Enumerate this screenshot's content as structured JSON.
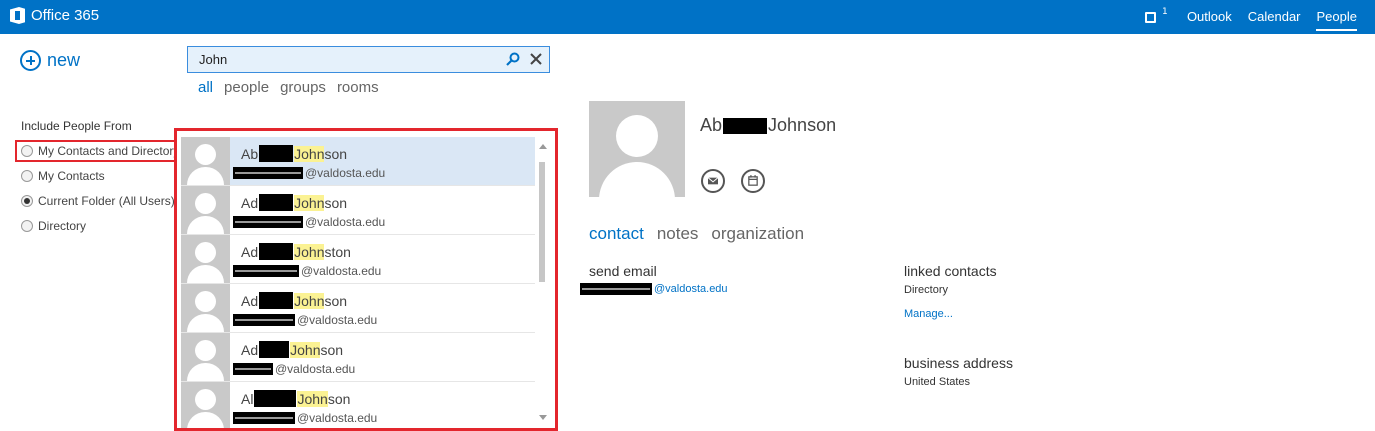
{
  "app": {
    "brand": "Office 365"
  },
  "topnav": {
    "notification_count": "1",
    "links": [
      "Outlook",
      "Calendar",
      "People"
    ],
    "active": "People"
  },
  "actions": {
    "new_label": "new"
  },
  "search": {
    "value": "John",
    "placeholder": ""
  },
  "filters": {
    "all": "all",
    "people": "people",
    "groups": "groups",
    "rooms": "rooms",
    "active": "all"
  },
  "include": {
    "title": "Include People From",
    "options": [
      {
        "label": "My Contacts and Directory",
        "checked": false
      },
      {
        "label": "My Contacts",
        "checked": false
      },
      {
        "label": "Current Folder (All Users)",
        "checked": true
      },
      {
        "label": "Directory",
        "checked": false
      }
    ]
  },
  "results": [
    {
      "prefix": "Ab",
      "match": "John",
      "suffix": "son",
      "domain": "@valdosta.edu",
      "selected": true
    },
    {
      "prefix": "Ad",
      "match": "John",
      "suffix": "son",
      "domain": "@valdosta.edu",
      "selected": false
    },
    {
      "prefix": "Ad",
      "match": "John",
      "suffix": "ston",
      "domain": "@valdosta.edu",
      "selected": false
    },
    {
      "prefix": "Ad",
      "match": "John",
      "suffix": "son",
      "domain": "@valdosta.edu",
      "selected": false
    },
    {
      "prefix": "Ad",
      "match": "John",
      "suffix": "son",
      "domain": "@valdosta.edu",
      "selected": false
    },
    {
      "prefix": "Al",
      "match": "John",
      "suffix": "son",
      "domain": "@valdosta.edu",
      "selected": false
    }
  ],
  "detail": {
    "name_prefix": "Ab",
    "name_suffix": "Johnson",
    "tabs": [
      "contact",
      "notes",
      "organization"
    ],
    "active_tab": "contact",
    "send_email_label": "send email",
    "email_domain": "@valdosta.edu",
    "linked_contacts_label": "linked contacts",
    "linked_contacts_value": "Directory",
    "manage_label": "Manage...",
    "business_address_label": "business address",
    "business_address_value": "United States"
  },
  "colors": {
    "brand_blue": "#0072c6",
    "highlight": "#fbf293",
    "annotation_red": "#e3262d",
    "selected_row": "#dae7f5"
  }
}
